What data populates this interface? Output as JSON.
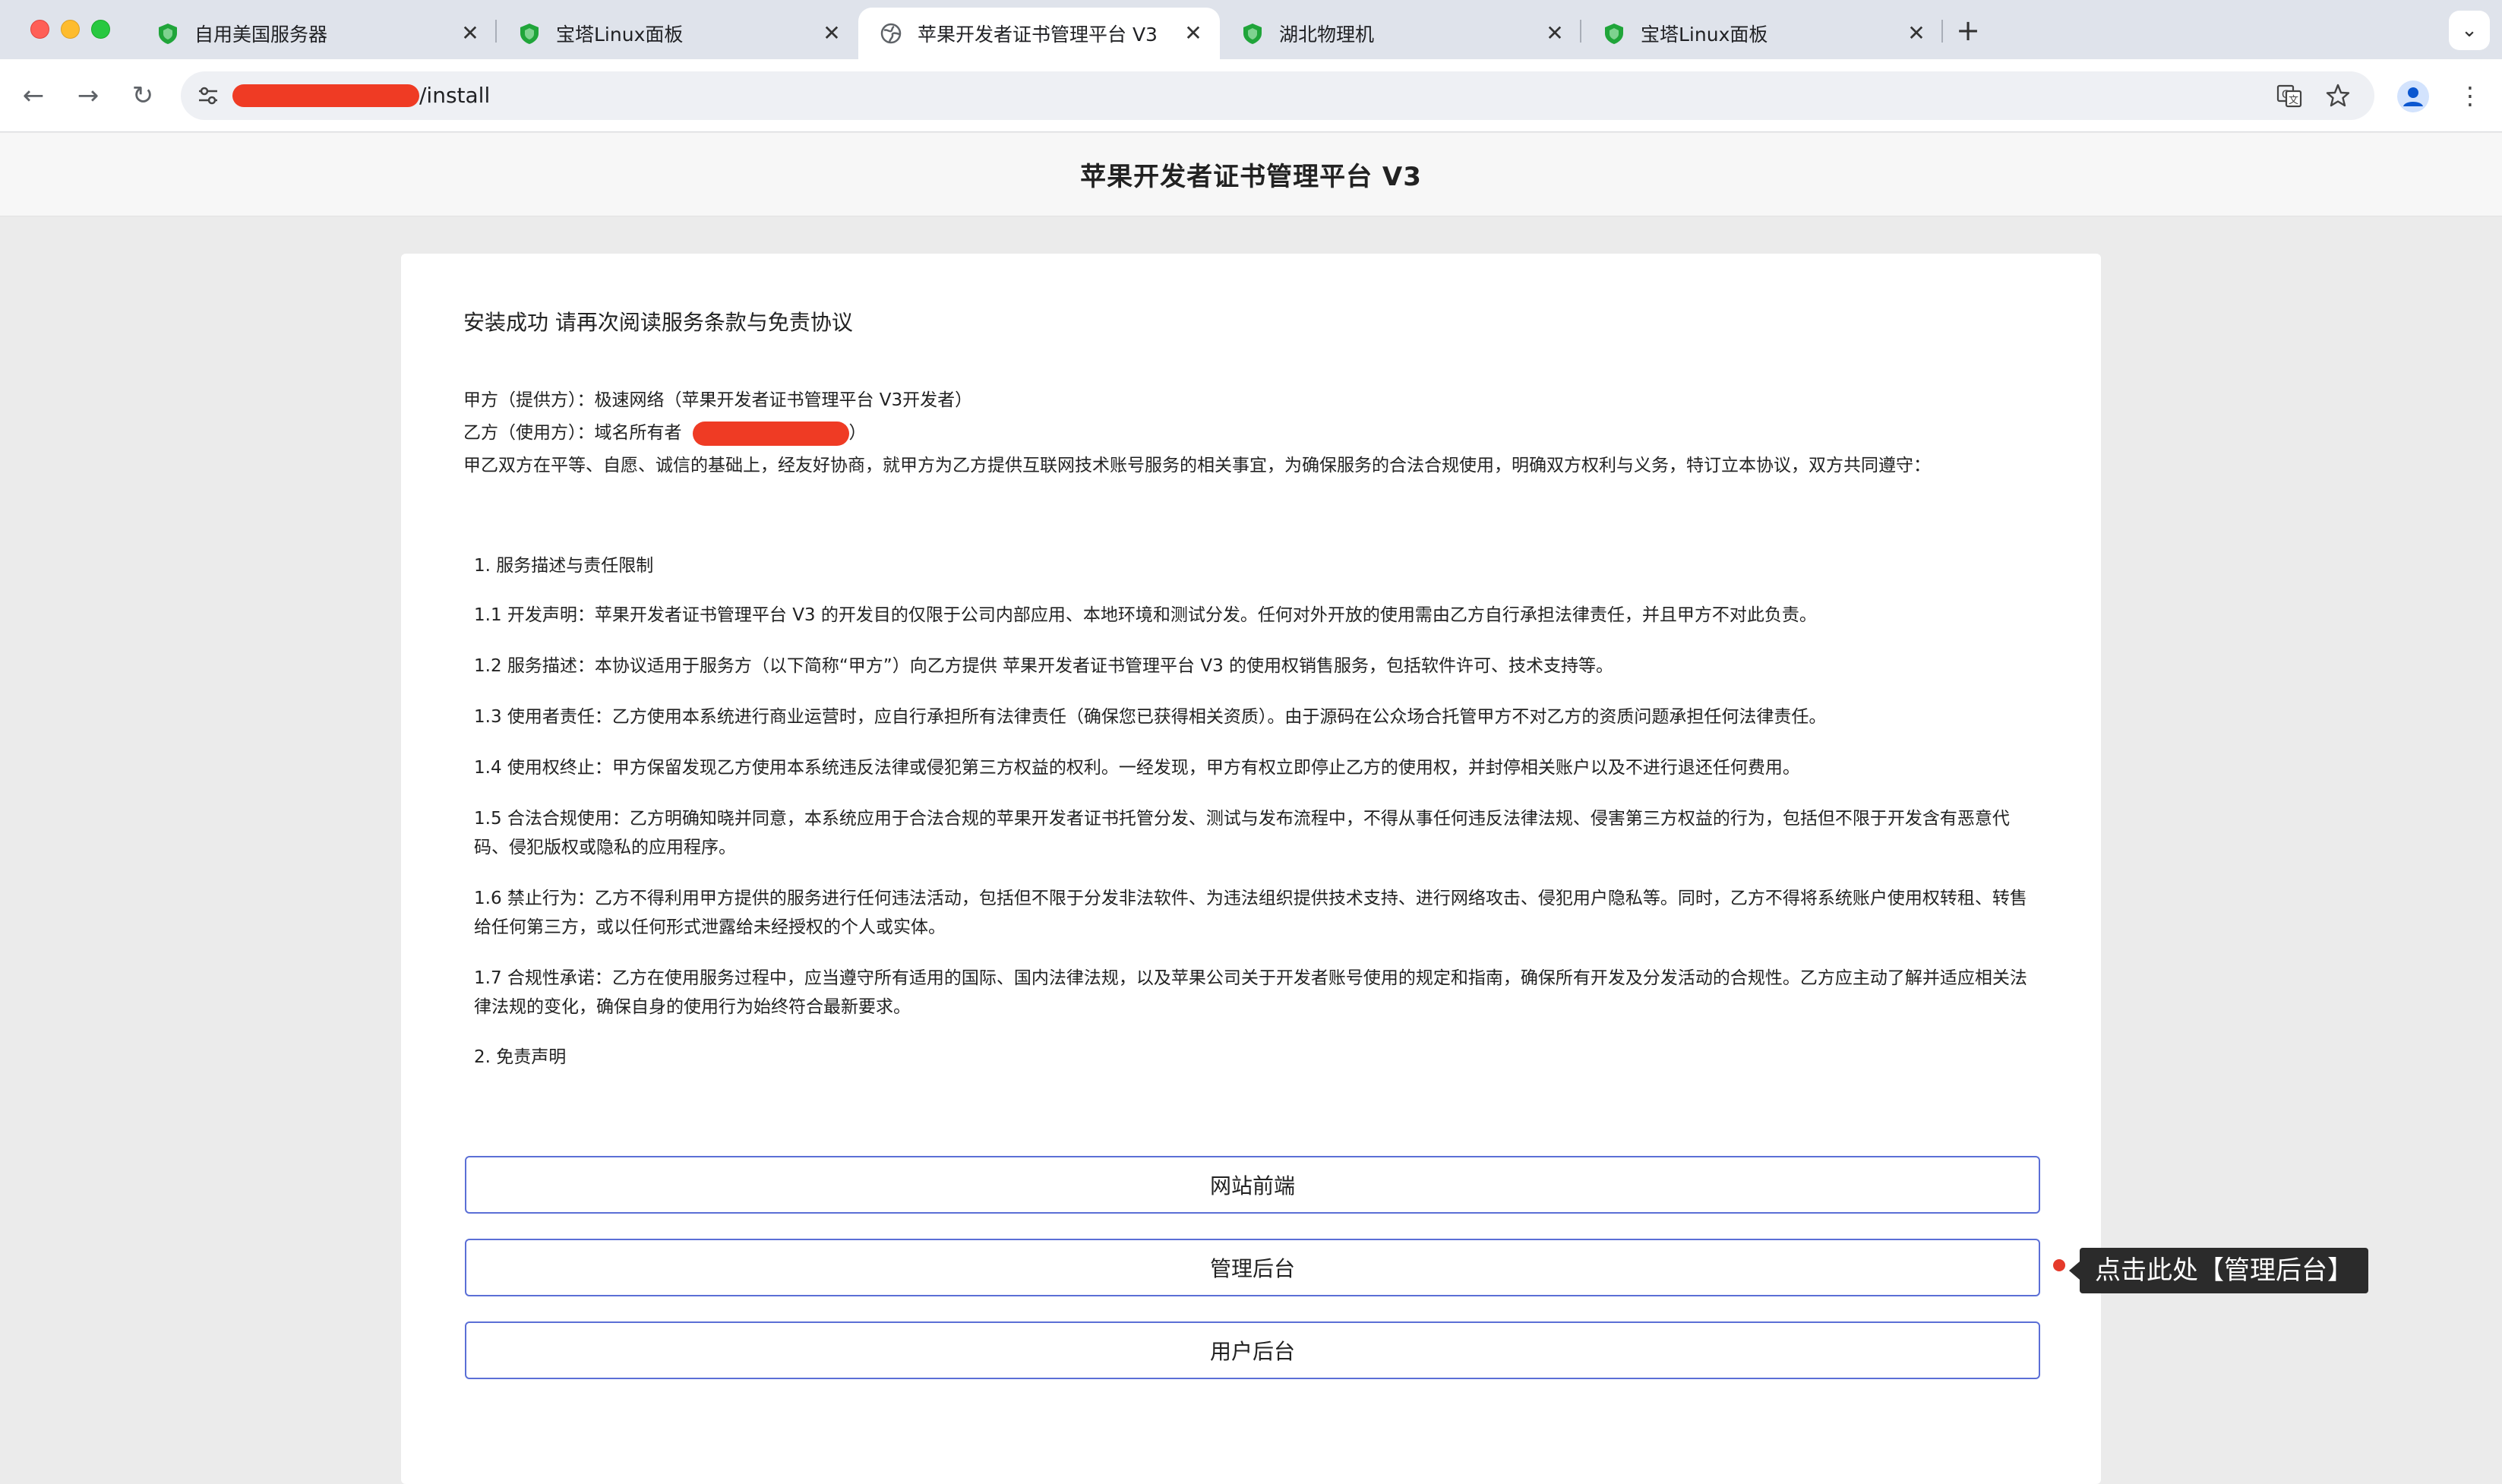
{
  "browser": {
    "tabs": [
      {
        "title": "自用美国服务器",
        "icon": "shield-icon",
        "active": false
      },
      {
        "title": "宝塔Linux面板",
        "icon": "shield-icon",
        "active": false
      },
      {
        "title": "苹果开发者证书管理平台 V3",
        "icon": "globe-icon",
        "active": true
      },
      {
        "title": "湖北物理机",
        "icon": "shield-icon",
        "active": false
      },
      {
        "title": "宝塔Linux面板",
        "icon": "shield-icon",
        "active": false
      }
    ],
    "close_glyph": "✕",
    "new_tab_glyph": "+",
    "tab_menu_glyph": "⌄",
    "url_path": "/install",
    "nav": {
      "back": "←",
      "forward": "→",
      "reload": "↻"
    },
    "kebab_glyph": "⋮"
  },
  "page": {
    "header_title": "苹果开发者证书管理平台 V3",
    "success_title": "安装成功 请再次阅读服务条款与免责协议",
    "party_a": "甲方（提供方）：极速网络（苹果开发者证书管理平台 V3开发者）",
    "party_b_prefix": "乙方（使用方）：域名所有者",
    "party_b_suffix": "）",
    "intro": "甲乙双方在平等、自愿、诚信的基础上，经友好协商，就甲方为乙方提供互联网技术账号服务的相关事宜，为确保服务的合法合规使用，明确双方权利与义务，特订立本协议，双方共同遵守：",
    "section1_title": "1. 服务描述与责任限制",
    "clauses": [
      "1.1 开发声明：苹果开发者证书管理平台 V3 的开发目的仅限于公司内部应用、本地环境和测试分发。任何对外开放的使用需由乙方自行承担法律责任，并且甲方不对此负责。",
      "1.2 服务描述：本协议适用于服务方（以下简称“甲方”）向乙方提供 苹果开发者证书管理平台 V3 的使用权销售服务，包括软件许可、技术支持等。",
      "1.3 使用者责任：乙方使用本系统进行商业运营时，应自行承担所有法律责任（确保您已获得相关资质）。由于源码在公众场合托管甲方不对乙方的资质问题承担任何法律责任。",
      "1.4 使用权终止：甲方保留发现乙方使用本系统违反法律或侵犯第三方权益的权利。一经发现，甲方有权立即停止乙方的使用权，并封停相关账户以及不进行退还任何费用。",
      "1.5 合法合规使用：乙方明确知晓并同意，本系统应用于合法合规的苹果开发者证书托管分发、测试与发布流程中，不得从事任何违反法律法规、侵害第三方权益的行为，包括但不限于开发含有恶意代码、侵犯版权或隐私的应用程序。",
      "1.6 禁止行为：乙方不得利用甲方提供的服务进行任何违法活动，包括但不限于分发非法软件、为违法组织提供技术支持、进行网络攻击、侵犯用户隐私等。同时，乙方不得将系统账户使用权转租、转售给任何第三方，或以任何形式泄露给未经授权的个人或实体。",
      "1.7 合规性承诺：乙方在使用服务过程中，应当遵守所有适用的国际、国内法律法规，以及苹果公司关于开发者账号使用的规定和指南，确保所有开发及分发活动的合规性。乙方应主动了解并适应相关法律法规的变化，确保自身的使用行为始终符合最新要求。"
    ],
    "section2_title": "2. 免责声明",
    "buttons": {
      "frontend": "网站前端",
      "admin": "管理后台",
      "user": "用户后台"
    },
    "annotation": "点击此处【管理后台】"
  },
  "colors": {
    "accent_border": "#5b6fd6",
    "redaction": "#ef3b24",
    "annotation_dot": "#e53a2b"
  }
}
